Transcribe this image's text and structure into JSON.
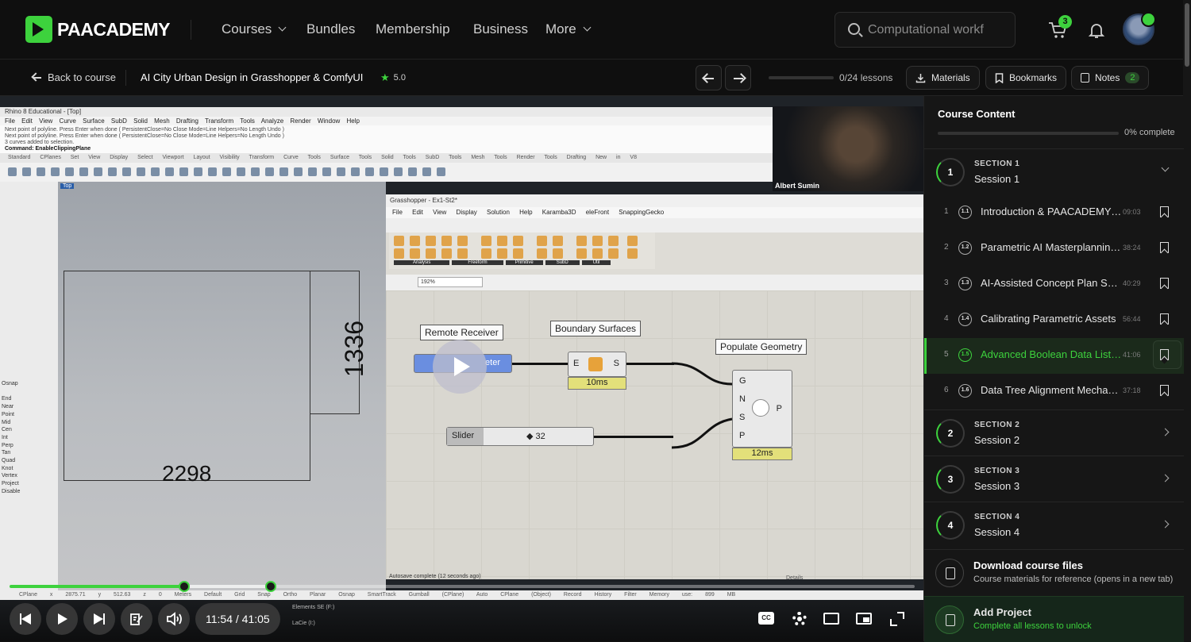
{
  "topnav": {
    "logo": "PAACADEMY",
    "items": [
      {
        "label": "Courses",
        "dropdown": true
      },
      {
        "label": "Bundles",
        "dropdown": false
      },
      {
        "label": "Membership",
        "dropdown": false
      },
      {
        "label": "Business",
        "dropdown": false
      },
      {
        "label": "More",
        "dropdown": true
      }
    ],
    "search_placeholder": "Computational workf",
    "cart_count": "3"
  },
  "coursebar": {
    "back_label": "Back to course",
    "title": "AI City Urban Design in Grasshopper & ComfyUI",
    "rating": "5.0",
    "lessons_progress": "0/24 lessons",
    "materials_label": "Materials",
    "bookmarks_label": "Bookmarks",
    "notes_label": "Notes",
    "notes_count": "2"
  },
  "video": {
    "presenter_name": "Albert Sumin",
    "rhino_title": "Rhino 8 Educational - [Top]",
    "rhino_menu": "File Edit View Curve Surface SubD Solid Mesh Drafting Transform Tools Analyze Render Window Help",
    "rhino_cmd": [
      "Next point of polyline. Press Enter when done ( PersistentClose=No Close Mode=Line Helpers=No Length Undo )",
      "Next point of polyline. Press Enter when done ( PersistentClose=No Close Mode=Line Helpers=No Length Undo )",
      "3 curves added to selection.",
      "Command: EnableClippingPlane"
    ],
    "rhino_tabs": "Standard CPlanes Set View Display Select Viewport Layout Visibility Transform Curve Tools Surface Tools Solid Tools SubD Tools Mesh Tools Render Tools Drafting New in V8",
    "viewport_tag": "Top",
    "dim_vertical": "1336",
    "dim_horizontal": "2298",
    "osnap_items": [
      "Osnap",
      "End",
      "Near",
      "Point",
      "Mid",
      "Cen",
      "Int",
      "Perp",
      "Tan",
      "Quad",
      "Knot",
      "Vertex",
      "Project",
      "Disable"
    ],
    "gh_title": "Grasshopper - Ex1-St2*",
    "gh_menu": "File Edit View Display Solution Help Karamba3D eleFront SnappingGecko",
    "gh_zoom": "192%",
    "gh_palette_groups": [
      "Analysis",
      "Freeform",
      "Primitive",
      "SubD",
      "Util"
    ],
    "gh_autosave": "Autosave complete (12 seconds ago)",
    "gh_nodes": {
      "remote_receiver": "Remote Receiver",
      "remote_param": "eter",
      "boundary_surfaces": "Boundary Surfaces",
      "boundary_in": "E",
      "boundary_out": "S",
      "boundary_ms": "10ms",
      "populate_geometry": "Populate Geometry",
      "populate_inputs": [
        "G",
        "N",
        "S",
        "P"
      ],
      "populate_out": "P",
      "populate_ms": "12ms",
      "slider_label": "Slider",
      "slider_value": "32"
    },
    "status_line": "CPlane x 2875.71 y 512.63 z 0 Meters Default Grid Snap Ortho Planar Osnap SmartTrack Gumball (CPlane) Auto CPlane (Object) Record History Filter Memory use: 899 MB",
    "layer_rows": [
      "Elements SE (F:)",
      "LaCie (I:)"
    ],
    "details_label": "Details",
    "time": "11:54 / 41:05",
    "progress_fraction": 0.193,
    "buffer_fraction": 0.289,
    "cc_label": "CC"
  },
  "sidebar": {
    "title": "Course Content",
    "progress_label": "0% complete",
    "section1": {
      "num": "1",
      "label": "SECTION 1",
      "name": "Session 1"
    },
    "lessons": [
      {
        "n": "1",
        "code": "1.1",
        "title": "Introduction & PAACADEMY ...",
        "time": "09:03",
        "active": false
      },
      {
        "n": "2",
        "code": "1.2",
        "title": "Parametric AI Masterplanning...",
        "time": "38:24",
        "active": false
      },
      {
        "n": "3",
        "code": "1.3",
        "title": "AI-Assisted Concept Plan Syn...",
        "time": "40:29",
        "active": false
      },
      {
        "n": "4",
        "code": "1.4",
        "title": "Calibrating Parametric Assets",
        "time": "56:44",
        "active": false
      },
      {
        "n": "5",
        "code": "1.5",
        "title": "Advanced Boolean Data List ...",
        "time": "41:06",
        "active": true
      },
      {
        "n": "6",
        "code": "1.6",
        "title": "Data Tree Alignment Mechani...",
        "time": "37:18",
        "active": false
      }
    ],
    "sections": [
      {
        "num": "2",
        "label": "SECTION 2",
        "name": "Session 2"
      },
      {
        "num": "3",
        "label": "SECTION 3",
        "name": "Session 3"
      },
      {
        "num": "4",
        "label": "SECTION 4",
        "name": "Session 4"
      }
    ],
    "download": {
      "title": "Download course files",
      "subtitle": "Course materials for reference (opens in a new tab)"
    },
    "add_project": {
      "title": "Add Project",
      "subtitle": "Complete all lessons to unlock"
    }
  },
  "colors": {
    "accent": "#3dd23d",
    "background": "#0f0f0f",
    "panel": "#161616"
  }
}
